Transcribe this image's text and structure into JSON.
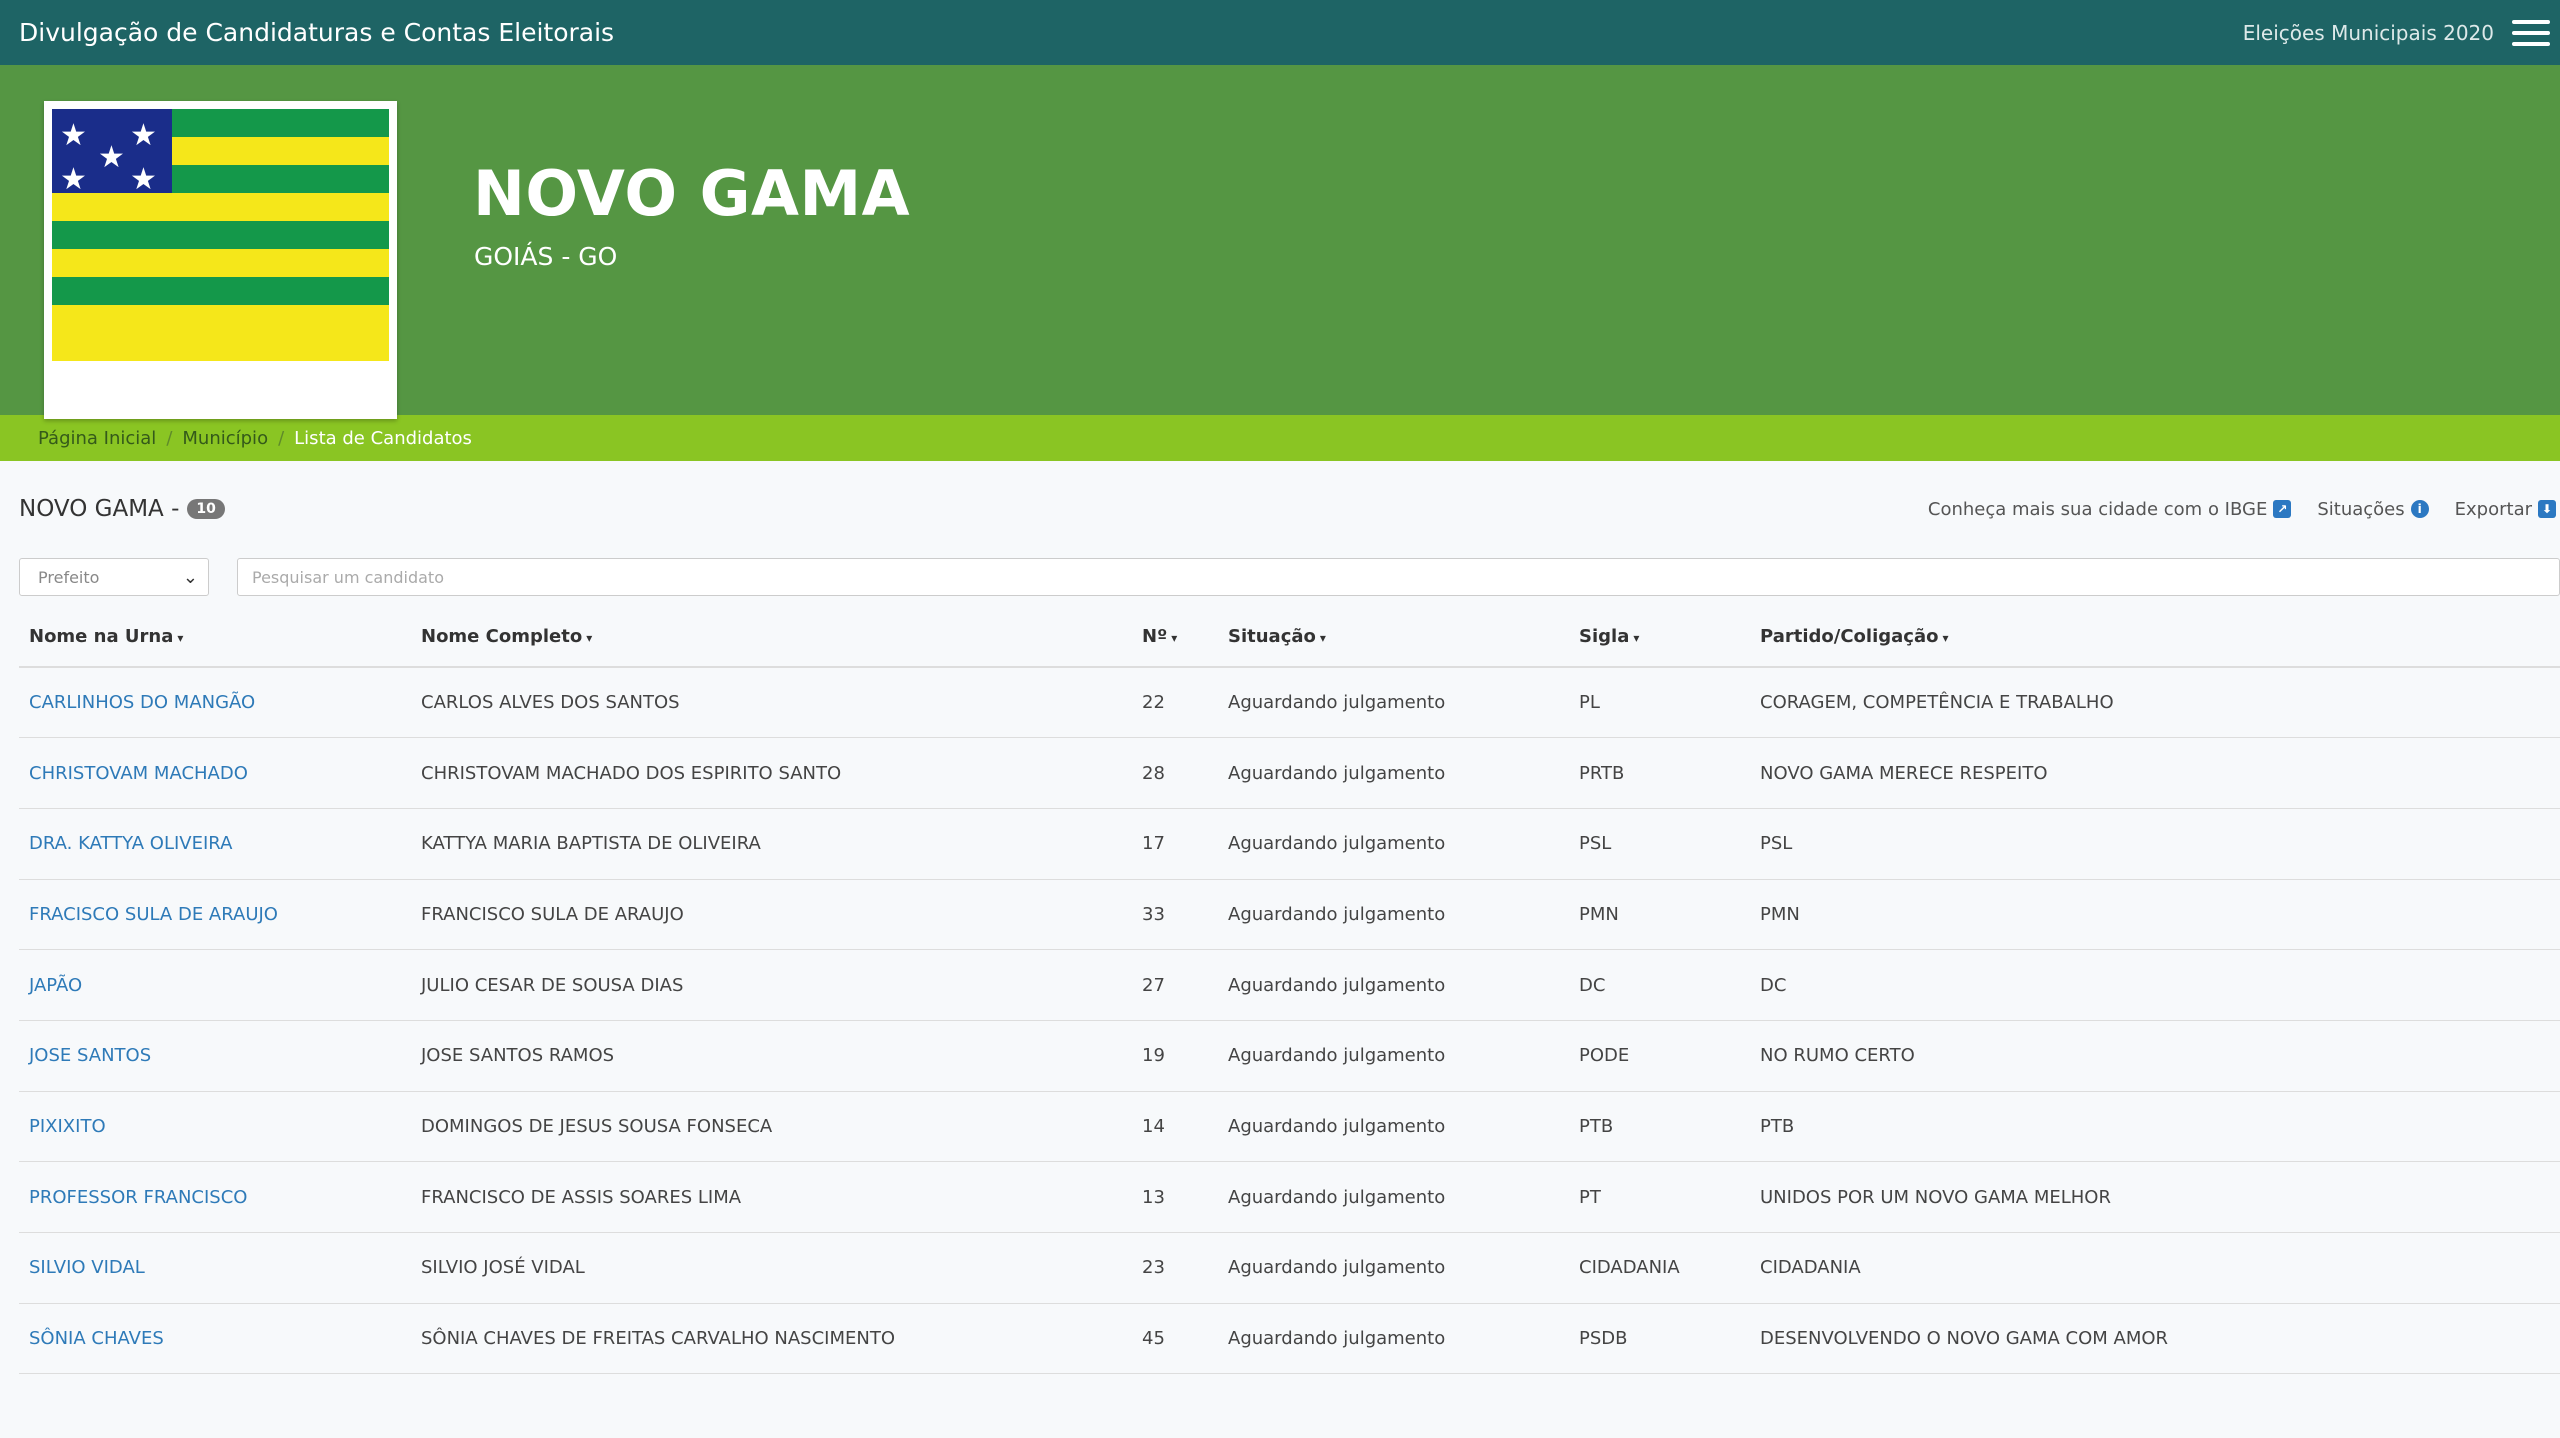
{
  "topbar": {
    "title": "Divulgação de Candidaturas e Contas Eleitorais",
    "election": "Eleições Municipais 2020"
  },
  "hero": {
    "city": "NOVO GAMA",
    "state": "GOIÁS - GO"
  },
  "breadcrumb": {
    "home": "Página Inicial",
    "municipality": "Município",
    "current": "Lista de Candidatos"
  },
  "list": {
    "title": "NOVO GAMA -",
    "count": "10",
    "ibge_link": "Conheça mais sua cidade com o IBGE",
    "situacoes": "Situações",
    "exportar": "Exportar"
  },
  "filters": {
    "office_selected": "Prefeito",
    "search_placeholder": "Pesquisar um candidato"
  },
  "table": {
    "headers": [
      "Nome na Urna",
      "Nome Completo",
      "Nº",
      "Situação",
      "Sigla",
      "Partido/Coligação"
    ],
    "rows": [
      [
        "CARLINHOS DO MANGÃO",
        "CARLOS ALVES DOS SANTOS",
        "22",
        "Aguardando julgamento",
        "PL",
        "CORAGEM, COMPETÊNCIA E TRABALHO"
      ],
      [
        "CHRISTOVAM MACHADO",
        "CHRISTOVAM MACHADO DOS ESPIRITO SANTO",
        "28",
        "Aguardando julgamento",
        "PRTB",
        "NOVO GAMA MERECE RESPEITO"
      ],
      [
        "DRA. KATTYA OLIVEIRA",
        "KATTYA MARIA BAPTISTA DE OLIVEIRA",
        "17",
        "Aguardando julgamento",
        "PSL",
        "PSL"
      ],
      [
        "FRACISCO SULA DE ARAUJO",
        "FRANCISCO SULA DE ARAUJO",
        "33",
        "Aguardando julgamento",
        "PMN",
        "PMN"
      ],
      [
        "JAPÃO",
        "JULIO CESAR DE SOUSA DIAS",
        "27",
        "Aguardando julgamento",
        "DC",
        "DC"
      ],
      [
        "JOSE SANTOS",
        "JOSE SANTOS RAMOS",
        "19",
        "Aguardando julgamento",
        "PODE",
        "NO RUMO CERTO"
      ],
      [
        "PIXIXITO",
        "DOMINGOS DE JESUS SOUSA FONSECA",
        "14",
        "Aguardando julgamento",
        "PTB",
        "PTB"
      ],
      [
        "PROFESSOR FRANCISCO",
        "FRANCISCO DE ASSIS SOARES LIMA",
        "13",
        "Aguardando julgamento",
        "PT",
        "UNIDOS POR UM NOVO GAMA MELHOR"
      ],
      [
        "SILVIO VIDAL",
        "SILVIO JOSÉ VIDAL",
        "23",
        "Aguardando julgamento",
        "CIDADANIA",
        "CIDADANIA"
      ],
      [
        "SÔNIA CHAVES",
        "SÔNIA CHAVES DE FREITAS CARVALHO NASCIMENTO",
        "45",
        "Aguardando julgamento",
        "PSDB",
        "DESENVOLVENDO O NOVO GAMA COM AMOR"
      ]
    ]
  },
  "colors": {
    "topbar": "#1e6465",
    "hero": "#559643",
    "breadcrumb": "#8ac523",
    "link": "#2e7ab8"
  }
}
